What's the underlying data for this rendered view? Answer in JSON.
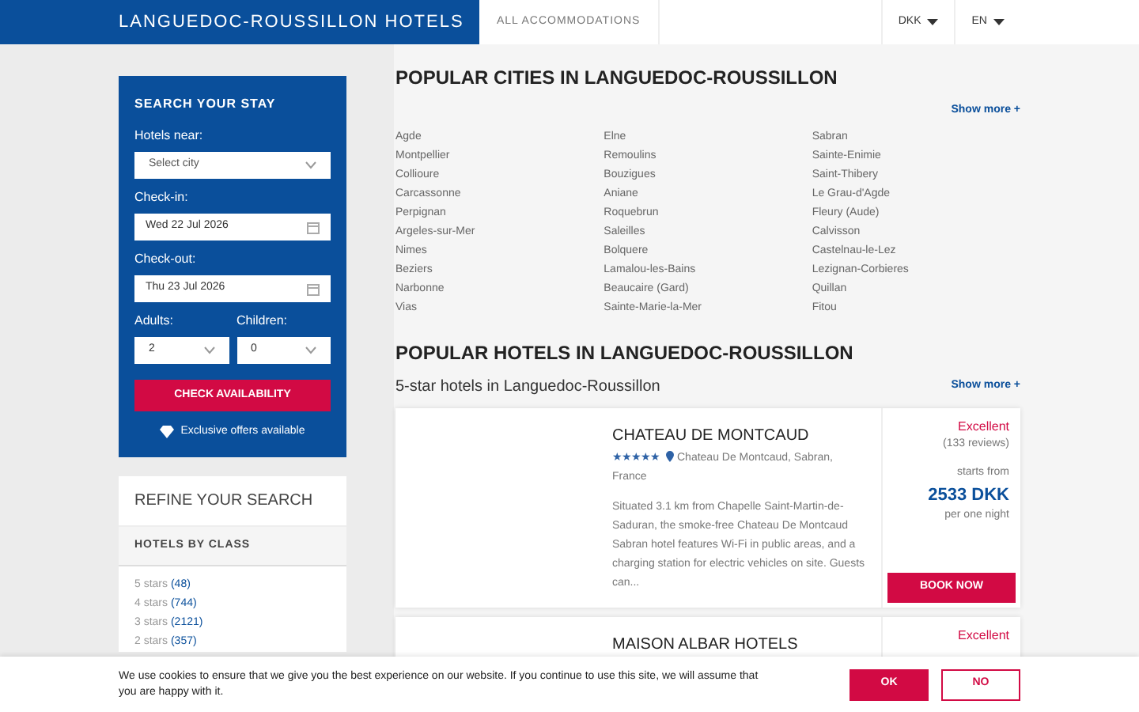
{
  "header": {
    "brand": "LANGUEDOC-ROUSSILLON HOTELS",
    "nav": [
      "ALL ACCOMMODATIONS"
    ],
    "currency": "DKK",
    "language": "EN"
  },
  "search": {
    "title": "SEARCH YOUR STAY",
    "near_label": "Hotels near:",
    "near_placeholder": "Select city",
    "checkin_label": "Check-in:",
    "checkin": "Wed 22 Jul 2026",
    "checkout_label": "Check-out:",
    "checkout": "Thu 23 Jul 2026",
    "adults_label": "Adults:",
    "adults": "2",
    "children_label": "Children:",
    "children": "0",
    "button": "CHECK AVAILABILITY",
    "offers": "Exclusive offers available"
  },
  "refine": {
    "title": "REFINE YOUR SEARCH",
    "section": "HOTELS BY CLASS",
    "classes": [
      {
        "label": "5 stars",
        "count": "(48)"
      },
      {
        "label": "4 stars",
        "count": "(744)"
      },
      {
        "label": "3 stars",
        "count": "(2121)"
      },
      {
        "label": "2 stars",
        "count": "(357)"
      }
    ]
  },
  "cities": {
    "title": "POPULAR CITIES IN LANGUEDOC-ROUSSILLON",
    "show_more": "Show more +",
    "columns": [
      [
        "Agde",
        "Montpellier",
        "Collioure",
        "Carcassonne",
        "Perpignan",
        "Argeles-sur-Mer",
        "Nimes",
        "Beziers",
        "Narbonne",
        "Vias"
      ],
      [
        "Elne",
        "Remoulins",
        "Bouzigues",
        "Aniane",
        "Roquebrun",
        "Saleilles",
        "Bolquere",
        "Lamalou-les-Bains",
        "Beaucaire (Gard)",
        "Sainte-Marie-la-Mer"
      ],
      [
        "Sabran",
        "Sainte-Enimie",
        "Saint-Thibery",
        "Le Grau-d'Agde",
        "Fleury (Aude)",
        "Calvisson",
        "Castelnau-le-Lez",
        "Lezignan-Corbieres",
        "Quillan",
        "Fitou"
      ]
    ]
  },
  "hotels": {
    "title": "POPULAR HOTELS IN LANGUEDOC-ROUSSILLON",
    "subtitle": "5-star hotels in Languedoc-Roussillon",
    "show_more": "Show more +",
    "items": [
      {
        "name": "CHATEAU DE MONTCAUD",
        "stars": 5,
        "address": "Chateau De Montcaud, Sabran, France",
        "description": "Situated 3.1 km from Chapelle Saint-Martin-de-Saduran, the smoke-free Chateau De Montcaud Sabran hotel features Wi-Fi in public areas, and a charging station for electric vehicles on site. Guests can...",
        "rating": "Excellent",
        "reviews": "(133 reviews)",
        "price_label": "starts from",
        "price": "2533 DKK",
        "price_unit": "per one night",
        "button": "BOOK NOW"
      },
      {
        "name": "MAISON ALBAR HOTELS",
        "rating": "Excellent"
      }
    ]
  },
  "cookie": {
    "text": "We use cookies to ensure that we give you the best experience on our website. If you continue to use this site, we will assume that you are happy with it.",
    "ok": "OK",
    "no": "NO"
  }
}
